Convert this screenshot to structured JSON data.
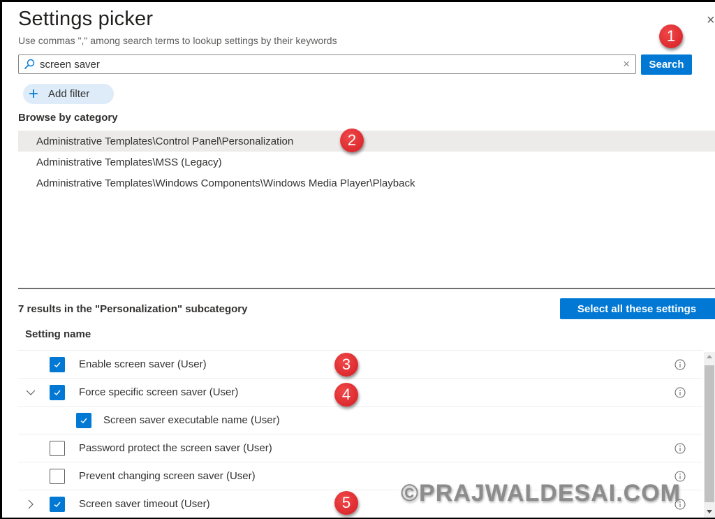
{
  "header": {
    "title": "Settings picker",
    "subtitle": "Use commas \",\" among search terms to lookup settings by their keywords",
    "close_icon": "close-icon"
  },
  "search": {
    "value": "screen saver",
    "search_icon": "search-icon",
    "clear_icon": "clear-icon",
    "button_label": "Search"
  },
  "filter": {
    "add_filter_label": "Add filter",
    "icon": "plus-icon"
  },
  "browse": {
    "heading": "Browse by category",
    "categories": [
      {
        "label": "Administrative Templates\\Control Panel\\Personalization",
        "selected": true
      },
      {
        "label": "Administrative Templates\\MSS (Legacy)",
        "selected": false
      },
      {
        "label": "Administrative Templates\\Windows Components\\Windows Media Player\\Playback",
        "selected": false
      }
    ]
  },
  "results": {
    "summary": "7 results in the \"Personalization\" subcategory",
    "select_all_label": "Select all these settings",
    "column_header": "Setting name",
    "rows": [
      {
        "label": "Enable screen saver (User)",
        "checked": true,
        "expander": "none",
        "indent": 0,
        "info": true
      },
      {
        "label": "Force specific screen saver (User)",
        "checked": true,
        "expander": "expanded",
        "indent": 0,
        "info": true
      },
      {
        "label": "Screen saver executable name (User)",
        "checked": true,
        "expander": "none",
        "indent": 1,
        "info": false
      },
      {
        "label": "Password protect the screen saver (User)",
        "checked": false,
        "expander": "none",
        "indent": 0,
        "info": true
      },
      {
        "label": "Prevent changing screen saver (User)",
        "checked": false,
        "expander": "none",
        "indent": 0,
        "info": true
      },
      {
        "label": "Screen saver timeout (User)",
        "checked": true,
        "expander": "collapsed",
        "indent": 0,
        "info": true
      }
    ]
  },
  "annotations": {
    "badges": [
      "1",
      "2",
      "3",
      "4",
      "5"
    ],
    "watermark": "©PRAJWALDESAI.COM"
  },
  "colors": {
    "accent": "#0078d4",
    "badge": "#d41e25",
    "selected_row": "#edebe9"
  }
}
